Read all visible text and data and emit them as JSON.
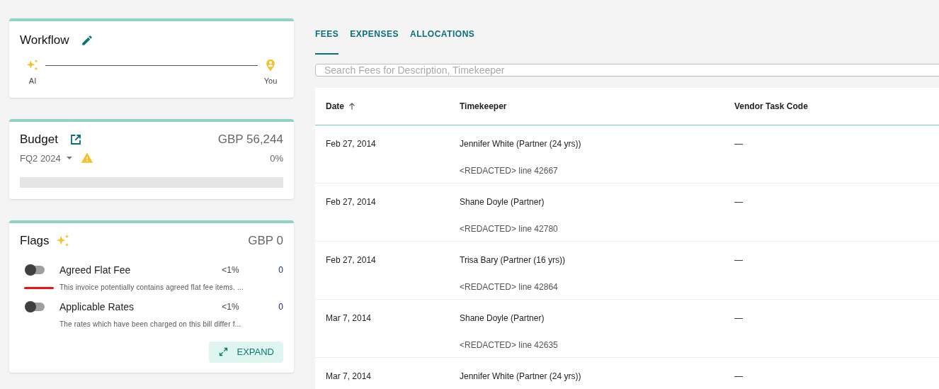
{
  "workflow": {
    "title": "Workflow",
    "steps": [
      {
        "label": "AI",
        "kind": "ai"
      },
      {
        "label": "You",
        "kind": "user"
      }
    ]
  },
  "budget": {
    "title": "Budget",
    "amount": "GBP 56,244",
    "period": "FQ2 2024",
    "warning": true,
    "percent": "0%",
    "level": 0
  },
  "flags": {
    "title": "Flags",
    "amount": "GBP 0",
    "items": [
      {
        "name": "Agreed Flat Fee",
        "share": "<1%",
        "count": "0",
        "description": "This invoice potentially contains agreed flat fee items. ...",
        "on": false,
        "underlined": true
      },
      {
        "name": "Applicable Rates",
        "share": "<1%",
        "count": "0",
        "description": "The rates which have been charged on this bill differ f...",
        "on": false,
        "underlined": false
      }
    ],
    "expand_button": "EXPAND"
  },
  "tabs": [
    {
      "label": "FEES",
      "selected": true
    },
    {
      "label": "EXPENSES",
      "selected": false
    },
    {
      "label": "ALLOCATIONS",
      "selected": false
    }
  ],
  "search": {
    "placeholder": "Search Fees for Description, Timekeeper"
  },
  "table": {
    "columns": [
      {
        "label": "Date",
        "sorted": true
      },
      {
        "label": "Timekeeper",
        "sorted": false
      },
      {
        "label": "Vendor Task Code",
        "sorted": false
      }
    ],
    "rows": [
      {
        "date": "Feb 27, 2014",
        "timekeeper": "Jennifer White (Partner (24 yrs))",
        "description": "<REDACTED> line 42667",
        "task_code": "—"
      },
      {
        "date": "Feb 27, 2014",
        "timekeeper": "Shane Doyle (Partner)",
        "description": "<REDACTED> line 42780",
        "task_code": "—"
      },
      {
        "date": "Feb 27, 2014",
        "timekeeper": "Trisa Bary (Partner (16 yrs))",
        "description": "<REDACTED> line 42864",
        "task_code": "—"
      },
      {
        "date": "Mar 7, 2014",
        "timekeeper": "Shane Doyle (Partner)",
        "description": "<REDACTED> line 42635",
        "task_code": "—"
      },
      {
        "date": "Mar 7, 2014",
        "timekeeper": "Jennifer White (Partner (24 yrs))",
        "task_code": "—"
      }
    ]
  }
}
